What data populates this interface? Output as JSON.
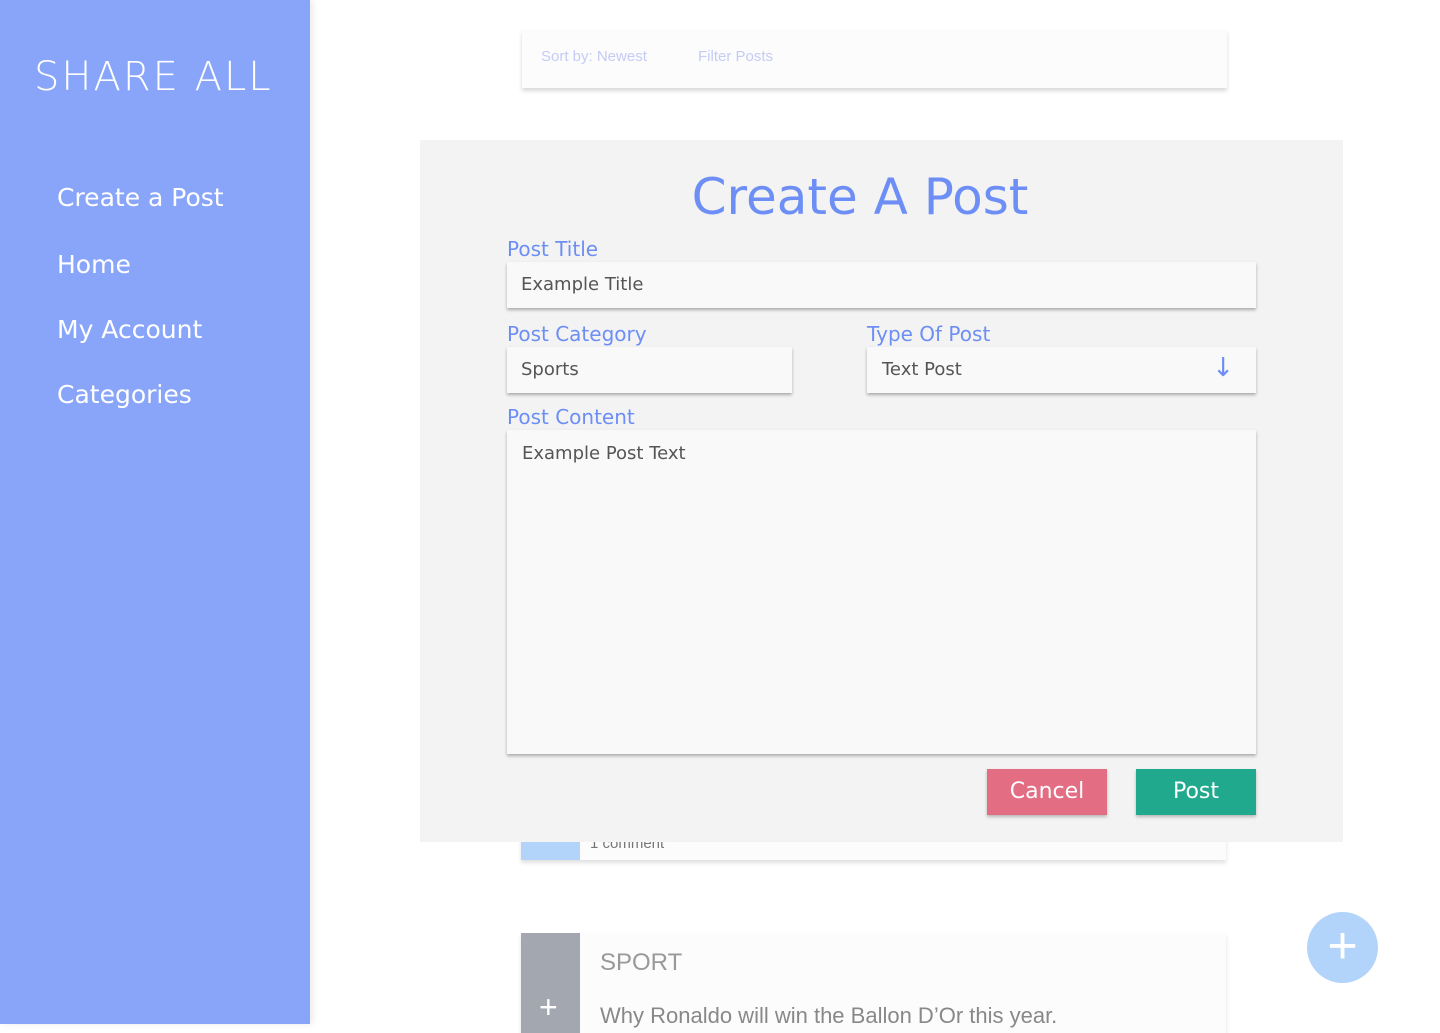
{
  "sidebar": {
    "logo": "SHARE ALL",
    "items": [
      {
        "label": "Create a Post"
      },
      {
        "label": "Home"
      },
      {
        "label": "My Account"
      },
      {
        "label": "Categories"
      }
    ]
  },
  "toolbar": {
    "sort": "Sort by: Newest",
    "filter": "Filter Posts"
  },
  "feed": {
    "comment_count": "1 comment",
    "post": {
      "category": "SPORT",
      "title": "Why Ronaldo will win the Ballon D’Or this year."
    }
  },
  "modal": {
    "title": "Create A Post",
    "post_title_label": "Post Title",
    "post_title_value": "Example Title",
    "category_label": "Post Category",
    "category_value": "Sports",
    "type_label": "Type Of Post",
    "type_value": "Text Post",
    "content_label": "Post Content",
    "content_value": "Example Post Text",
    "cancel": "Cancel",
    "post": "Post"
  },
  "colors": {
    "sidebar": "#88a5fa",
    "accent": "#6d8ef5",
    "cancel": "#e36d83",
    "post": "#20a98c",
    "fab": "#b3d4fa"
  }
}
